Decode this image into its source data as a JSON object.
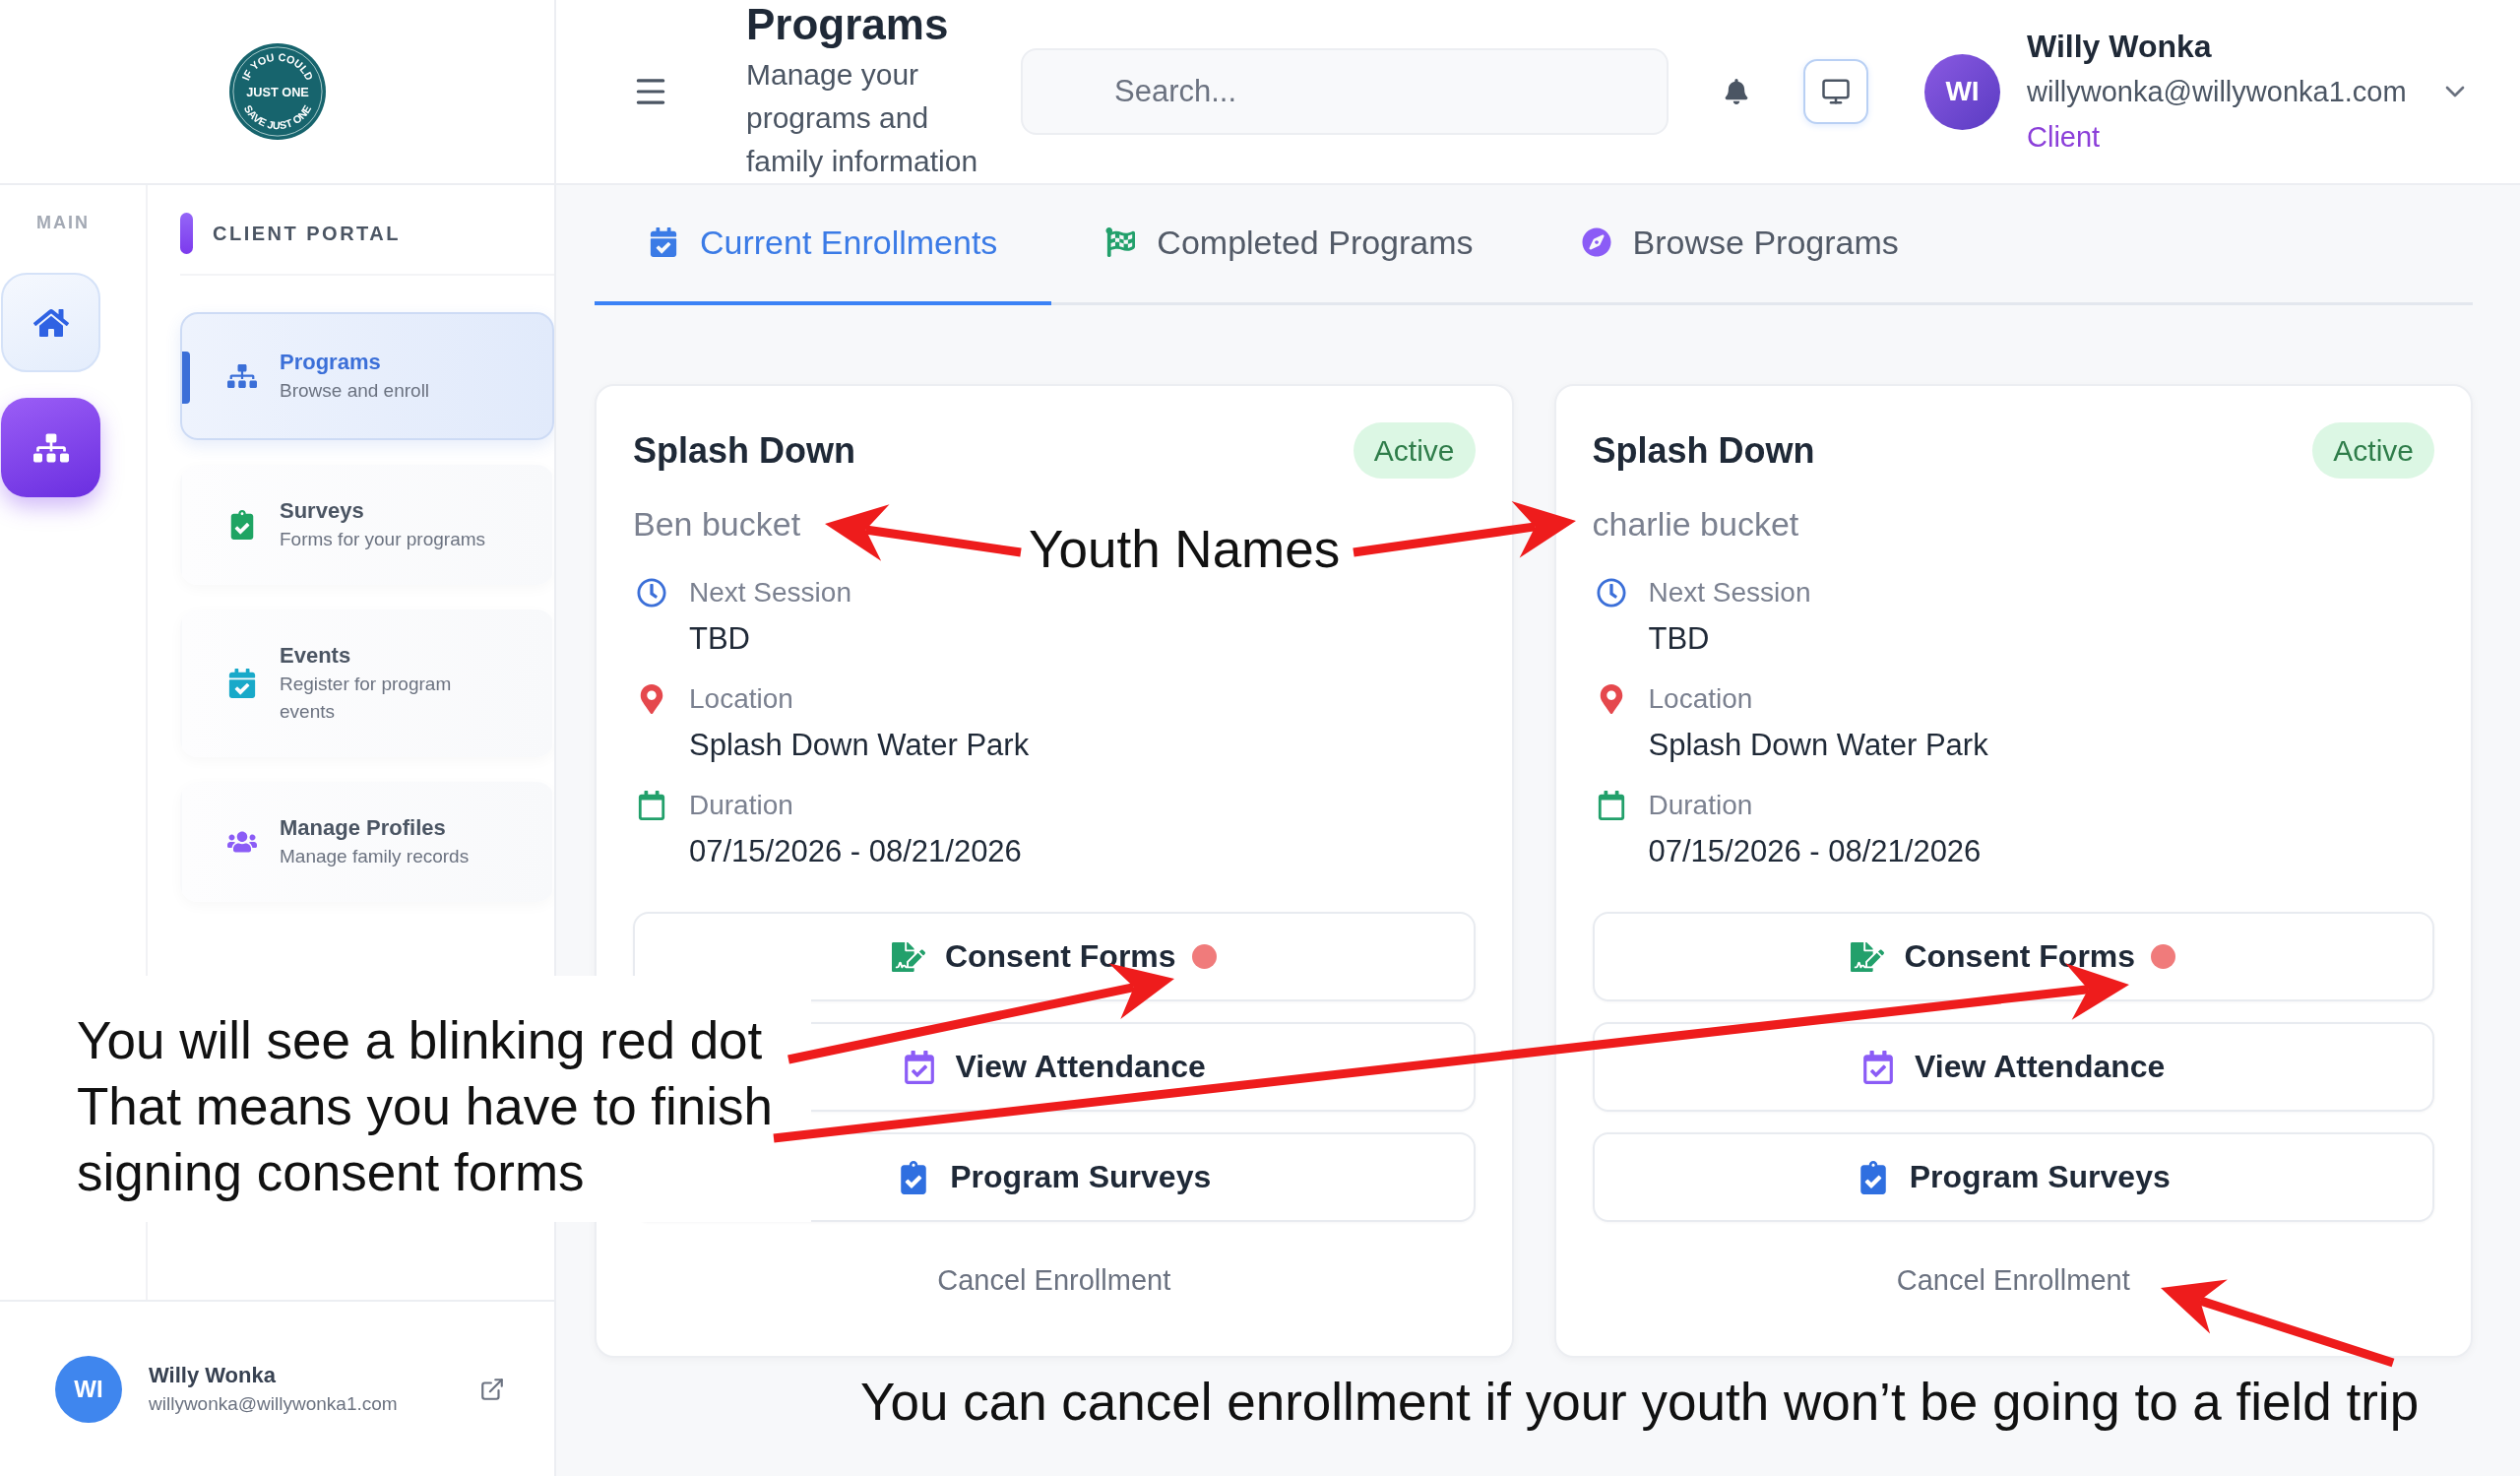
{
  "sidebar": {
    "logo": {
      "top_text": "IF YOU COULD",
      "center_text": "JUST ONE",
      "bottom_text": "SAVE JUST ONE"
    },
    "rail": {
      "label": "MAIN",
      "items": [
        {
          "kind": "home",
          "selected": false
        },
        {
          "kind": "programs",
          "selected": true
        }
      ]
    },
    "section_title": "CLIENT PORTAL",
    "nav": [
      {
        "kind": "programs",
        "title": "Programs",
        "subtitle": "Browse and enroll",
        "selected": true
      },
      {
        "kind": "surveys",
        "title": "Surveys",
        "subtitle": "Forms for your programs",
        "selected": false
      },
      {
        "kind": "events",
        "title": "Events",
        "subtitle": "Register for program events",
        "selected": false
      },
      {
        "kind": "profiles",
        "title": "Manage Profiles",
        "subtitle": "Manage family records",
        "selected": false
      }
    ],
    "user": {
      "initials": "WI",
      "name": "Willy Wonka",
      "email": "willywonka@willywonka1.com"
    }
  },
  "header": {
    "title": "Programs",
    "subtitle": "Manage your programs and family information",
    "search": {
      "placeholder": "Search..."
    },
    "user": {
      "initials": "WI",
      "name": "Willy Wonka",
      "email": "willywonka@willywonka1.com",
      "role": "Client"
    }
  },
  "tabs": [
    {
      "kind": "current",
      "label": "Current Enrollments",
      "selected": true
    },
    {
      "kind": "completed",
      "label": "Completed Programs",
      "selected": false
    },
    {
      "kind": "browse",
      "label": "Browse Programs",
      "selected": false
    }
  ],
  "enrollments": [
    {
      "program": "Splash Down",
      "status": "Active",
      "youth": "Ben bucket",
      "details": [
        {
          "kind": "session",
          "label": "Next Session",
          "value": "TBD"
        },
        {
          "kind": "location",
          "label": "Location",
          "value": "Splash Down Water Park"
        },
        {
          "kind": "duration",
          "label": "Duration",
          "value": "07/15/2026 - 08/21/2026"
        }
      ],
      "actions": [
        {
          "kind": "consent",
          "label": "Consent Forms",
          "alert": true
        },
        {
          "kind": "attendance",
          "label": "View Attendance",
          "alert": false
        },
        {
          "kind": "surveys",
          "label": "Program Surveys",
          "alert": false
        }
      ],
      "cancel": "Cancel Enrollment"
    },
    {
      "program": "Splash Down",
      "status": "Active",
      "youth": "charlie bucket",
      "details": [
        {
          "kind": "session",
          "label": "Next Session",
          "value": "TBD"
        },
        {
          "kind": "location",
          "label": "Location",
          "value": "Splash Down Water Park"
        },
        {
          "kind": "duration",
          "label": "Duration",
          "value": "07/15/2026 - 08/21/2026"
        }
      ],
      "actions": [
        {
          "kind": "consent",
          "label": "Consent Forms",
          "alert": true
        },
        {
          "kind": "attendance",
          "label": "View Attendance",
          "alert": false
        },
        {
          "kind": "surveys",
          "label": "Program Surveys",
          "alert": false
        }
      ],
      "cancel": "Cancel Enrollment"
    }
  ],
  "annotations": [
    {
      "kind": "youth",
      "texts": [
        "Youth Names"
      ]
    },
    {
      "kind": "consent",
      "texts": [
        "You will see a blinking red dot",
        "That means you have to finish signing consent forms"
      ]
    },
    {
      "kind": "cancel",
      "texts": [
        "You can cancel enrollment if your youth won’t be going to a field trip"
      ]
    }
  ]
}
